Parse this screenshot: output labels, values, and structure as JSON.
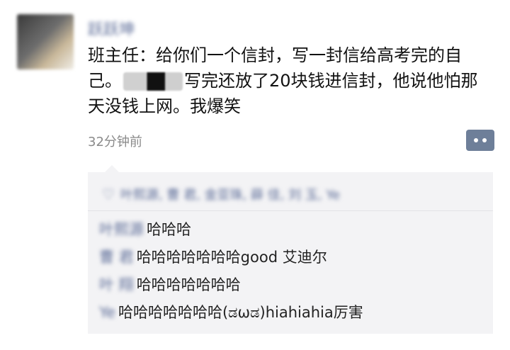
{
  "post": {
    "username": "跃跃坤",
    "text_part1": "班主任：给你们一个信封，写一封信给高考完的自己。",
    "text_part2": "写完还放了20块钱进信封，他说他怕那天没钱上网。我爆笑",
    "timestamp": "32分钟前"
  },
  "likes": {
    "names": "叶熙源, 曹 君, 金亚珠, 薛 佳, 刘 玉, Ye"
  },
  "comments": [
    {
      "author": "叶熙源",
      "text": "哈哈哈"
    },
    {
      "author": "曹 君",
      "text": "哈哈哈哈哈哈哈good 艾迪尔"
    },
    {
      "author": "叶 翔",
      "text": "哈哈哈哈哈哈哈"
    },
    {
      "author": "Ye",
      "text": "哈哈哈哈哈哈哈(ಡωಡ)hiahiahia厉害"
    }
  ],
  "icons": {
    "more": "more-dots-icon",
    "like": "heart-icon"
  },
  "colors": {
    "link": "#5b6b97",
    "more_button": "#6e7f99",
    "comment_bg": "#f3f3f5",
    "timestamp": "#8a8a8a"
  }
}
